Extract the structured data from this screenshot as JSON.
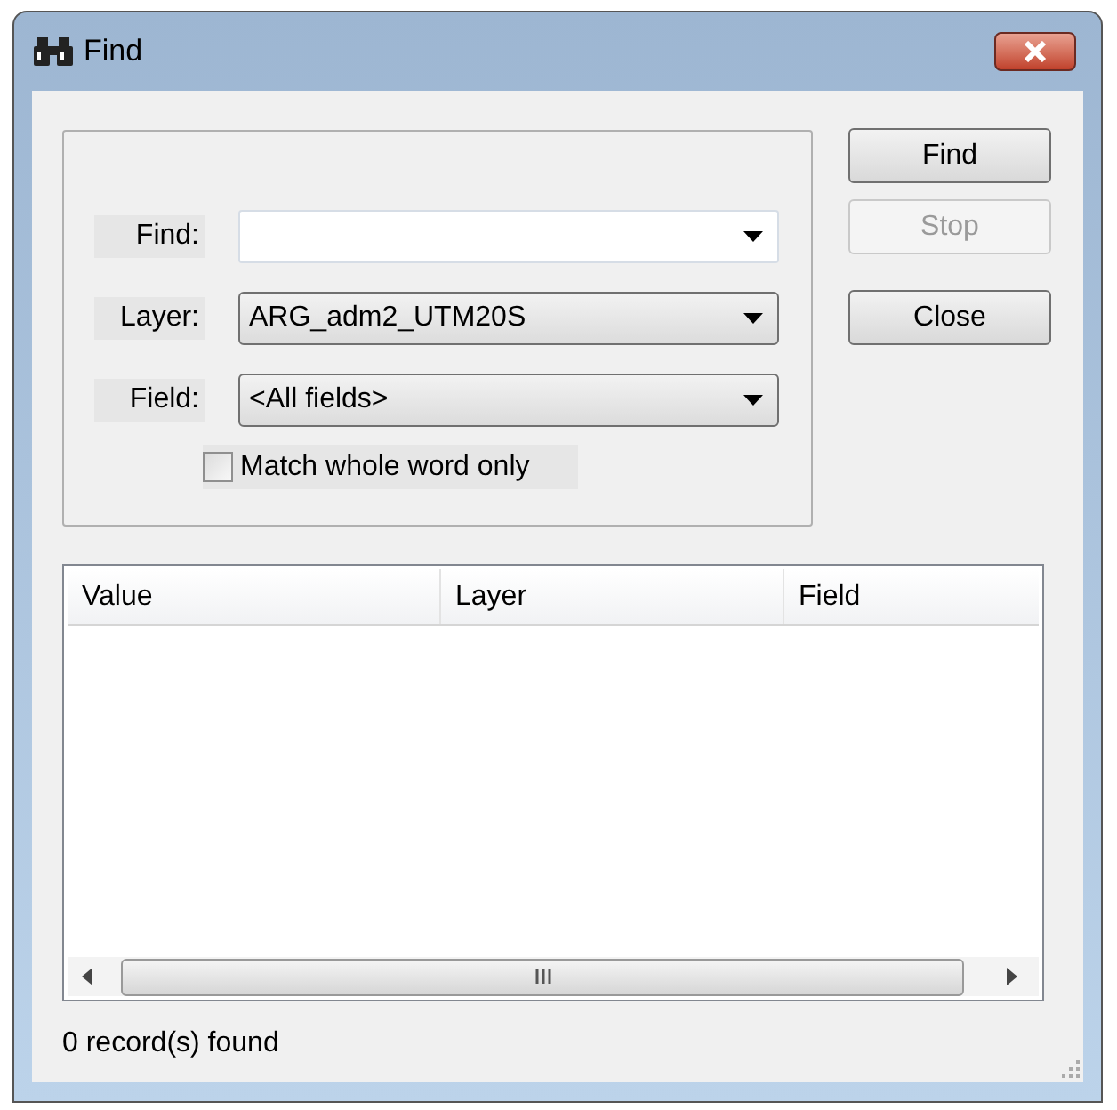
{
  "window": {
    "title": "Find"
  },
  "form": {
    "fields": [
      {
        "label": "Find:",
        "kind": "editable"
      },
      {
        "label": "Layer:",
        "kind": "dropdown",
        "value": "ARG_adm2_UTM20S"
      },
      {
        "label": "Field:",
        "kind": "dropdown",
        "value": "<All fields>"
      }
    ],
    "checkbox": {
      "label": "Match whole word only",
      "checked": false
    }
  },
  "buttons": [
    {
      "label": "Find",
      "disabled": false
    },
    {
      "label": "Stop",
      "disabled": true
    },
    {
      "label": "Close",
      "disabled": false
    }
  ],
  "table": {
    "columns": [
      "Value",
      "Layer",
      "Field"
    ]
  },
  "status_bar": "0 record(s) found"
}
